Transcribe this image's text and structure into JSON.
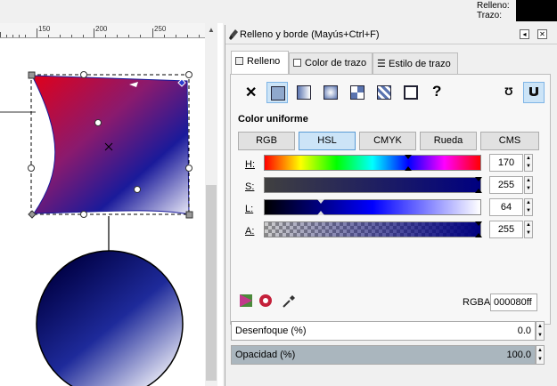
{
  "status": {
    "fill_label": "Relleno:",
    "stroke_label": "Trazo:",
    "fill_color": "#000000"
  },
  "ruler": {
    "ticks": [
      "150",
      "200",
      "250"
    ]
  },
  "dialog": {
    "title": "Relleno y borde (Mayús+Ctrl+F)",
    "tabs": [
      "Relleno",
      "Color de trazo",
      "Estilo de trazo"
    ],
    "section_title": "Color uniforme",
    "modes": [
      "RGB",
      "HSL",
      "CMYK",
      "Rueda",
      "CMS"
    ],
    "selected_mode": "HSL",
    "sliders": [
      {
        "label": "H:",
        "value": "170"
      },
      {
        "label": "S:",
        "value": "255"
      },
      {
        "label": "L:",
        "value": "64"
      },
      {
        "label": "A:",
        "value": "255"
      }
    ],
    "rgba_label": "RGBA:",
    "rgba_value": "000080ff",
    "blur": {
      "label": "Desenfoque (%)",
      "value": "0.0"
    },
    "opacity": {
      "label": "Opacidad (%)",
      "value": "100.0"
    }
  },
  "colors": {
    "current": "#000080",
    "selection_accent": "#cce4f7"
  },
  "slider_levels": {
    "H": 0.667,
    "S": 1.0,
    "L": 0.251,
    "A": 1.0
  }
}
